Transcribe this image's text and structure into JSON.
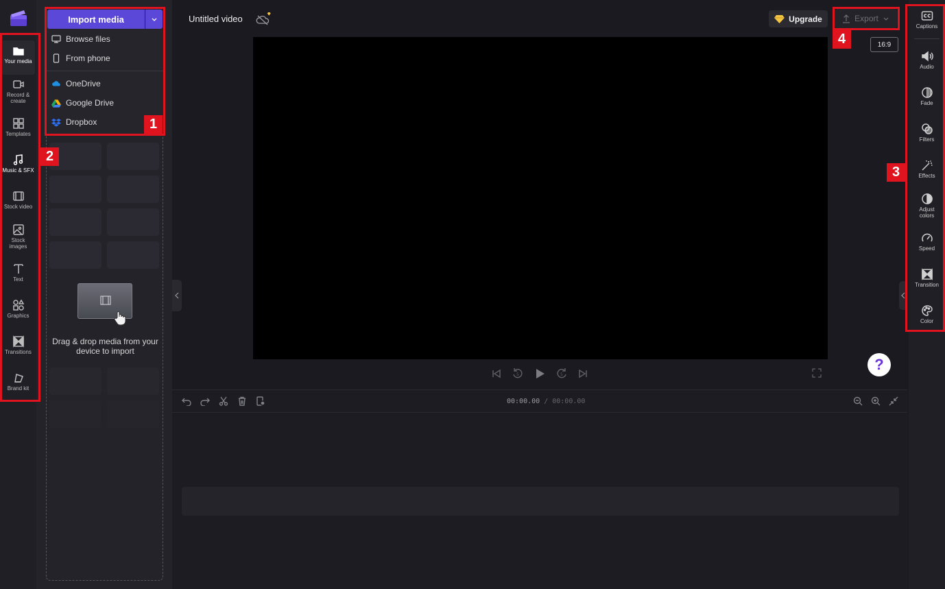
{
  "app": {
    "project_title": "Untitled video"
  },
  "left_nav": {
    "items": [
      {
        "label": "Your media",
        "icon": "folder-icon"
      },
      {
        "label": "Record &\ncreate",
        "icon": "camera-icon"
      },
      {
        "label": "Templates",
        "icon": "templates-icon"
      },
      {
        "label": "Music & SFX",
        "icon": "music-note-icon"
      },
      {
        "label": "Stock video",
        "icon": "film-icon"
      },
      {
        "label": "Stock\nimages",
        "icon": "image-icon"
      },
      {
        "label": "Text",
        "icon": "text-icon"
      },
      {
        "label": "Graphics",
        "icon": "shapes-icon"
      },
      {
        "label": "Transitions",
        "icon": "transitions-icon"
      },
      {
        "label": "Brand kit",
        "icon": "brand-kit-icon"
      }
    ]
  },
  "media_panel": {
    "import_label": "Import media",
    "menu": [
      {
        "label": "Browse files",
        "icon": "monitor-icon"
      },
      {
        "label": "From phone",
        "icon": "phone-icon"
      },
      {
        "label": "OneDrive",
        "icon": "onedrive-icon"
      },
      {
        "label": "Google Drive",
        "icon": "google-drive-icon"
      },
      {
        "label": "Dropbox",
        "icon": "dropbox-icon"
      }
    ],
    "drop_text": "Drag & drop media from your device to import"
  },
  "topbar": {
    "upgrade_label": "Upgrade",
    "export_label": "Export",
    "aspect_ratio": "16:9"
  },
  "timeline": {
    "current_time": "00:00.00",
    "separator": " / ",
    "total_time": "00:00.00"
  },
  "right_panel": {
    "items": [
      {
        "label": "Captions",
        "icon": "captions-icon"
      },
      {
        "label": "Audio",
        "icon": "speaker-icon"
      },
      {
        "label": "Fade",
        "icon": "fade-icon"
      },
      {
        "label": "Filters",
        "icon": "filters-icon"
      },
      {
        "label": "Effects",
        "icon": "magic-wand-icon"
      },
      {
        "label": "Adjust\ncolors",
        "icon": "contrast-icon"
      },
      {
        "label": "Speed",
        "icon": "speedometer-icon"
      },
      {
        "label": "Transition",
        "icon": "transition-icon"
      },
      {
        "label": "Color",
        "icon": "palette-icon"
      }
    ]
  },
  "callouts": {
    "one": "1",
    "two": "2",
    "three": "3",
    "four": "4"
  },
  "help": {
    "symbol": "?"
  },
  "colors": {
    "accent": "#5b48d9",
    "callout": "#e0141e",
    "background": "#1b1a20"
  }
}
